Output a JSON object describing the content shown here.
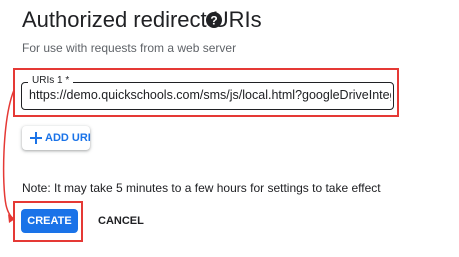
{
  "section": {
    "title": "Authorized redirect URIs",
    "subtitle": "For use with requests from a web server"
  },
  "uri_field": {
    "label": "URIs 1 *",
    "value": "https://demo.quickschools.com/sms/js/local.html?googleDriveIntegrationCo"
  },
  "add_uri": {
    "label": "ADD URI"
  },
  "note": "Note: It may take 5 minutes to a few hours for settings to take effect",
  "actions": {
    "create_label": "CREATE",
    "cancel_label": "CANCEL"
  },
  "colors": {
    "accent": "#1a73e8",
    "highlight": "#e53935",
    "text": "#202124",
    "muted": "#5f6368"
  },
  "icons": {
    "help": "help-circle-icon",
    "add": "plus-icon",
    "annotation": "annotation-arrow"
  }
}
